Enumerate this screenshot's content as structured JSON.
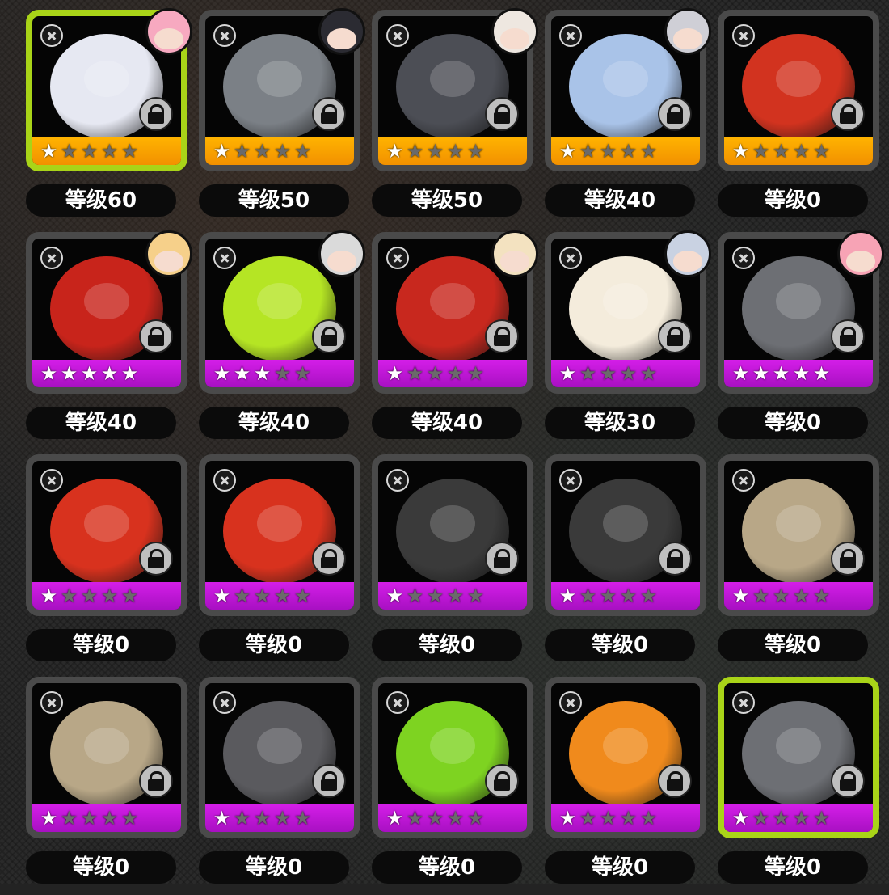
{
  "colors": {
    "gold_band": "#f29100",
    "purple_band": "#b317cf",
    "selected_border": "#a9d418",
    "frame": "#4a4a4a"
  },
  "items": [
    {
      "level_label": "等级60",
      "stars": 1,
      "rarity": "gold",
      "selected": true,
      "locked": true,
      "has_portrait": true,
      "portrait_color": "#f7a9c0",
      "art_color": "#e6e8f2",
      "icon": "ball-type-icon"
    },
    {
      "level_label": "等级50",
      "stars": 1,
      "rarity": "gold",
      "selected": false,
      "locked": true,
      "has_portrait": true,
      "portrait_color": "#2b2b32",
      "art_color": "#7b8086",
      "icon": "ball-type-icon"
    },
    {
      "level_label": "等级50",
      "stars": 1,
      "rarity": "gold",
      "selected": false,
      "locked": true,
      "has_portrait": true,
      "portrait_color": "#eee7e0",
      "art_color": "#4c4e55",
      "icon": "ball-type-icon"
    },
    {
      "level_label": "等级40",
      "stars": 1,
      "rarity": "gold",
      "selected": false,
      "locked": true,
      "has_portrait": true,
      "portrait_color": "#cfcfd6",
      "art_color": "#a9c3e8",
      "icon": "ball-type-icon"
    },
    {
      "level_label": "等级0",
      "stars": 1,
      "rarity": "gold",
      "selected": false,
      "locked": true,
      "has_portrait": false,
      "portrait_color": "",
      "art_color": "#d2331f",
      "icon": "ball-type-icon"
    },
    {
      "level_label": "等级40",
      "stars": 5,
      "rarity": "purple",
      "selected": false,
      "locked": true,
      "has_portrait": true,
      "portrait_color": "#f6d08a",
      "art_color": "#c8241b",
      "icon": "ball-type-icon"
    },
    {
      "level_label": "等级40",
      "stars": 3,
      "rarity": "purple",
      "selected": false,
      "locked": true,
      "has_portrait": true,
      "portrait_color": "#dadada",
      "art_color": "#b5e524",
      "icon": "hammer-type-icon"
    },
    {
      "level_label": "等级40",
      "stars": 1,
      "rarity": "purple",
      "selected": false,
      "locked": true,
      "has_portrait": true,
      "portrait_color": "#f3e2c0",
      "art_color": "#c8281e",
      "icon": "ball-type-icon"
    },
    {
      "level_label": "等级30",
      "stars": 1,
      "rarity": "purple",
      "selected": false,
      "locked": true,
      "has_portrait": true,
      "portrait_color": "#c9d2e2",
      "art_color": "#f4ecdc",
      "icon": "ball-type-icon"
    },
    {
      "level_label": "等级0",
      "stars": 5,
      "rarity": "purple",
      "selected": false,
      "locked": true,
      "has_portrait": true,
      "portrait_color": "#f7a3b5",
      "art_color": "#6d6f74",
      "icon": "ball-type-icon"
    },
    {
      "level_label": "等级0",
      "stars": 1,
      "rarity": "purple",
      "selected": false,
      "locked": true,
      "has_portrait": false,
      "portrait_color": "",
      "art_color": "#d8321e",
      "icon": "ball-type-icon"
    },
    {
      "level_label": "等级0",
      "stars": 1,
      "rarity": "purple",
      "selected": false,
      "locked": true,
      "has_portrait": false,
      "portrait_color": "",
      "art_color": "#d8321e",
      "icon": "ball-type-icon"
    },
    {
      "level_label": "等级0",
      "stars": 1,
      "rarity": "purple",
      "selected": false,
      "locked": true,
      "has_portrait": false,
      "portrait_color": "",
      "art_color": "#3a3a3a",
      "icon": "ball-type-icon"
    },
    {
      "level_label": "等级0",
      "stars": 1,
      "rarity": "purple",
      "selected": false,
      "locked": true,
      "has_portrait": false,
      "portrait_color": "",
      "art_color": "#3a3a3a",
      "icon": "ball-type-icon"
    },
    {
      "level_label": "等级0",
      "stars": 1,
      "rarity": "purple",
      "selected": false,
      "locked": true,
      "has_portrait": false,
      "portrait_color": "",
      "art_color": "#b8a787",
      "icon": "hammer-type-icon"
    },
    {
      "level_label": "等级0",
      "stars": 1,
      "rarity": "purple",
      "selected": false,
      "locked": true,
      "has_portrait": false,
      "portrait_color": "",
      "art_color": "#b8a787",
      "icon": "hammer-type-icon"
    },
    {
      "level_label": "等级0",
      "stars": 1,
      "rarity": "purple",
      "selected": false,
      "locked": true,
      "has_portrait": false,
      "portrait_color": "",
      "art_color": "#5a5a5e",
      "icon": "hammer-type-icon"
    },
    {
      "level_label": "等级0",
      "stars": 1,
      "rarity": "purple",
      "selected": false,
      "locked": true,
      "has_portrait": false,
      "portrait_color": "",
      "art_color": "#7ed321",
      "icon": "ball-type-icon"
    },
    {
      "level_label": "等级0",
      "stars": 1,
      "rarity": "purple",
      "selected": false,
      "locked": true,
      "has_portrait": false,
      "portrait_color": "",
      "art_color": "#f08a1c",
      "icon": "ball-type-icon"
    },
    {
      "level_label": "等级0",
      "stars": 1,
      "rarity": "purple",
      "selected": true,
      "locked": true,
      "has_portrait": false,
      "portrait_color": "",
      "art_color": "#6d6f74",
      "icon": "ball-type-icon"
    }
  ]
}
